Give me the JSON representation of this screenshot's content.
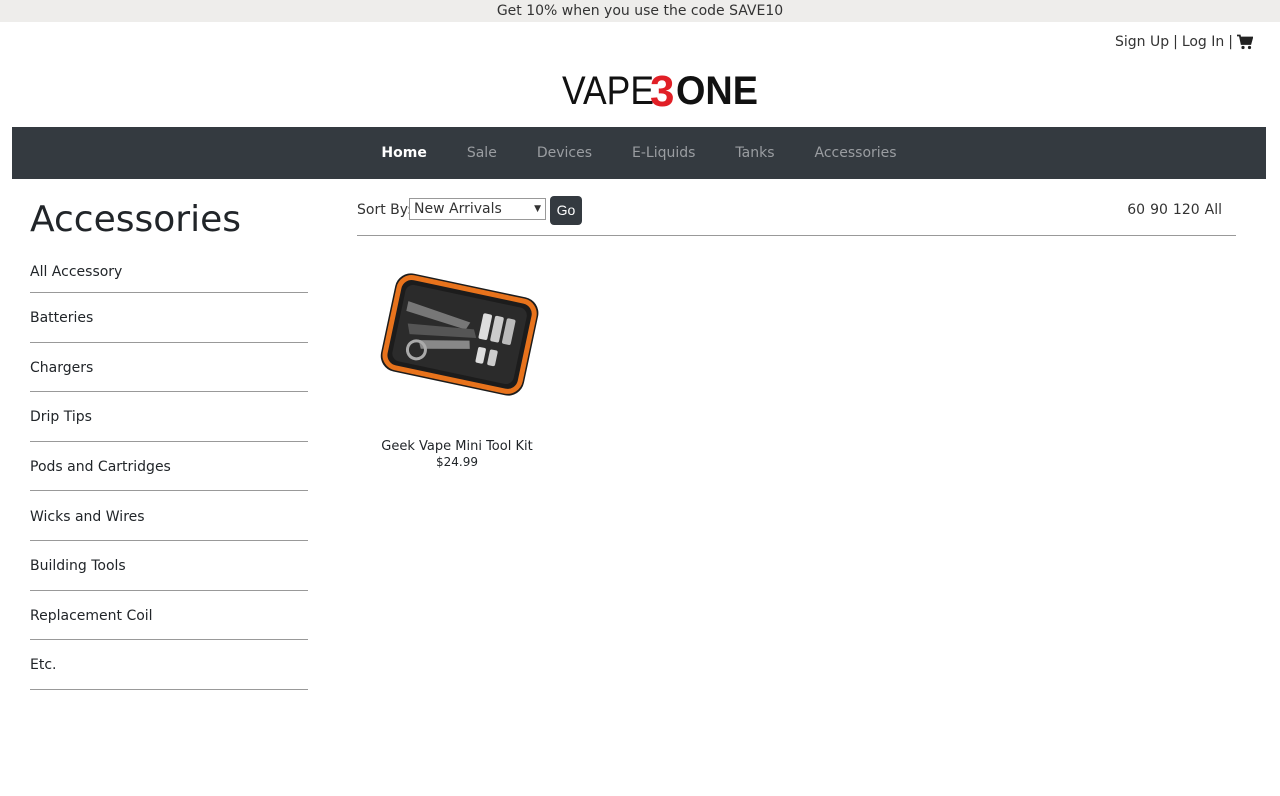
{
  "promo": {
    "text": "Get 10% when you use the code SAVE10"
  },
  "account": {
    "sign_up": "Sign Up",
    "separator1": "|",
    "log_in": "Log In",
    "separator2": "|"
  },
  "logo": {
    "text_vape": "VAPE",
    "text_3": "3",
    "text_one": "ONE"
  },
  "nav": {
    "items": [
      {
        "label": "Home"
      },
      {
        "label": "Sale"
      },
      {
        "label": "Devices"
      },
      {
        "label": "E-Liquids"
      },
      {
        "label": "Tanks"
      },
      {
        "label": "Accessories"
      }
    ]
  },
  "sidebar": {
    "title": "Accessories",
    "categories": [
      {
        "label": "All Accessory"
      },
      {
        "label": "Batteries"
      },
      {
        "label": "Chargers"
      },
      {
        "label": "Drip Tips"
      },
      {
        "label": "Pods and Cartridges"
      },
      {
        "label": "Wicks and Wires"
      },
      {
        "label": "Building Tools"
      },
      {
        "label": "Replacement Coil"
      },
      {
        "label": "Etc."
      }
    ]
  },
  "sort": {
    "label": "Sort By:",
    "selected": "New Arrivals",
    "go_label": "Go",
    "page_sizes": [
      "60",
      "90",
      "120",
      "All"
    ]
  },
  "products": [
    {
      "name": "Geek Vape Mini Tool Kit",
      "price": "$24.99"
    }
  ],
  "colors": {
    "nav_bg": "#343a40",
    "promo_bg": "#eeedeb",
    "logo_red": "#e11f26"
  }
}
